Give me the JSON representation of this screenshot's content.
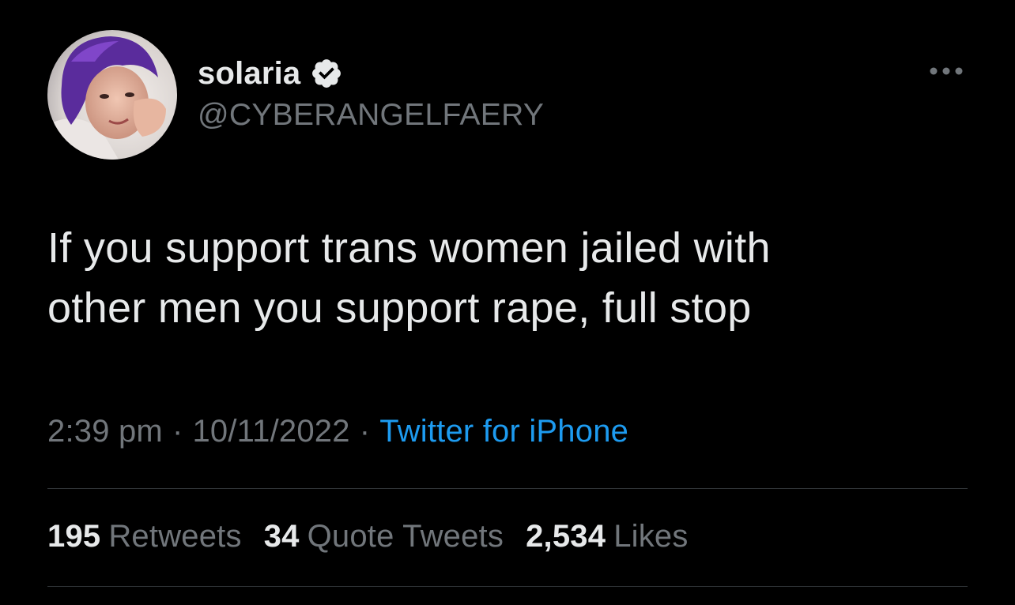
{
  "author": {
    "display_name": "solaria",
    "handle": "@CYBERANGELFAERY",
    "avatar_icon": "profile-photo",
    "verified_icon": "verified-badge-icon"
  },
  "menu_icon": "more-options-icon",
  "tweet": {
    "text_line1": "If you support trans women jailed with",
    "text_line2": "other men you support rape, full stop"
  },
  "meta": {
    "time": "2:39 pm",
    "separator": "·",
    "date": "10/11/2022",
    "source": "Twitter for iPhone"
  },
  "stats": {
    "retweets_count": "195",
    "retweets_label": "Retweets",
    "quotes_count": "34",
    "quotes_label": "Quote Tweets",
    "likes_count": "2,534",
    "likes_label": "Likes"
  },
  "colors": {
    "background": "#000000",
    "primary_text": "#e7e9ea",
    "secondary_text": "#71767b",
    "link": "#1d9bf0",
    "divider": "#2f3336"
  }
}
